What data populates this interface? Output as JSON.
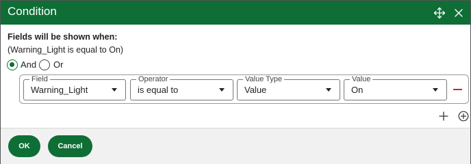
{
  "dialog": {
    "title": "Condition",
    "heading": "Fields will be shown when:",
    "summary": "(Warning_Light is equal to On)"
  },
  "logic": {
    "options": [
      {
        "label": "And",
        "selected": true
      },
      {
        "label": "Or",
        "selected": false
      }
    ]
  },
  "condition_row": {
    "field": {
      "label": "Field",
      "value": "Warning_Light"
    },
    "operator": {
      "label": "Operator",
      "value": "is equal to"
    },
    "value_type": {
      "label": "Value Type",
      "value": "Value"
    },
    "value": {
      "label": "Value",
      "value": "On"
    }
  },
  "buttons": {
    "ok": "OK",
    "cancel": "Cancel"
  },
  "colors": {
    "accent": "#0e6e36",
    "remove": "#c62828",
    "footer": "#f1f1f1"
  },
  "icons": {
    "move": "move-arrows-icon",
    "close": "close-icon",
    "remove_row": "minus-icon",
    "add_row": "plus-icon",
    "add_group": "plus-circle-icon"
  }
}
